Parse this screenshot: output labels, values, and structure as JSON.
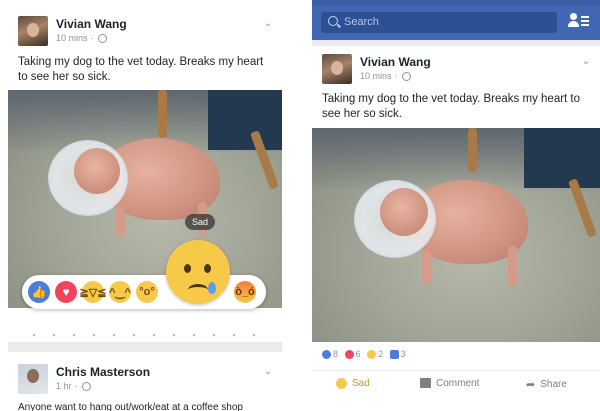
{
  "left": {
    "post": {
      "author": "Vivian Wang",
      "time": "10 mins",
      "separator": "·",
      "text": "Taking my dog to the vet today. Breaks my heart to see her so sick."
    },
    "reactions": {
      "tooltip": "Sad",
      "items": [
        "like-icon",
        "love-icon",
        "haha-icon",
        "yay-icon",
        "wow-icon",
        "sad-icon",
        "angry-icon"
      ],
      "selected": "Sad"
    },
    "next_post": {
      "author": "Chris Masterson",
      "time": "1 hr",
      "separator": "·",
      "preview": "Anyone want to hang out/work/eat at a coffee shop"
    }
  },
  "right": {
    "topbar": {
      "search_placeholder": "Search",
      "color": "#4267b2"
    },
    "post": {
      "author": "Vivian Wang",
      "time": "10 mins",
      "separator": "·",
      "text": "Taking my dog to the vet today. Breaks my heart to see her so sick."
    },
    "reaction_counts": [
      {
        "icon": "like-icon",
        "count": "8",
        "color": "#4a7ddf"
      },
      {
        "icon": "love-icon",
        "count": "6",
        "color": "#f0445d"
      },
      {
        "icon": "sad-icon",
        "count": "2",
        "color": "#f7c948"
      },
      {
        "icon": "comment-icon",
        "count": "3",
        "color": "#4a7ddf"
      }
    ],
    "actions": {
      "sad": "Sad",
      "comment": "Comment",
      "share": "Share",
      "active_color": "#c69a1d"
    }
  }
}
